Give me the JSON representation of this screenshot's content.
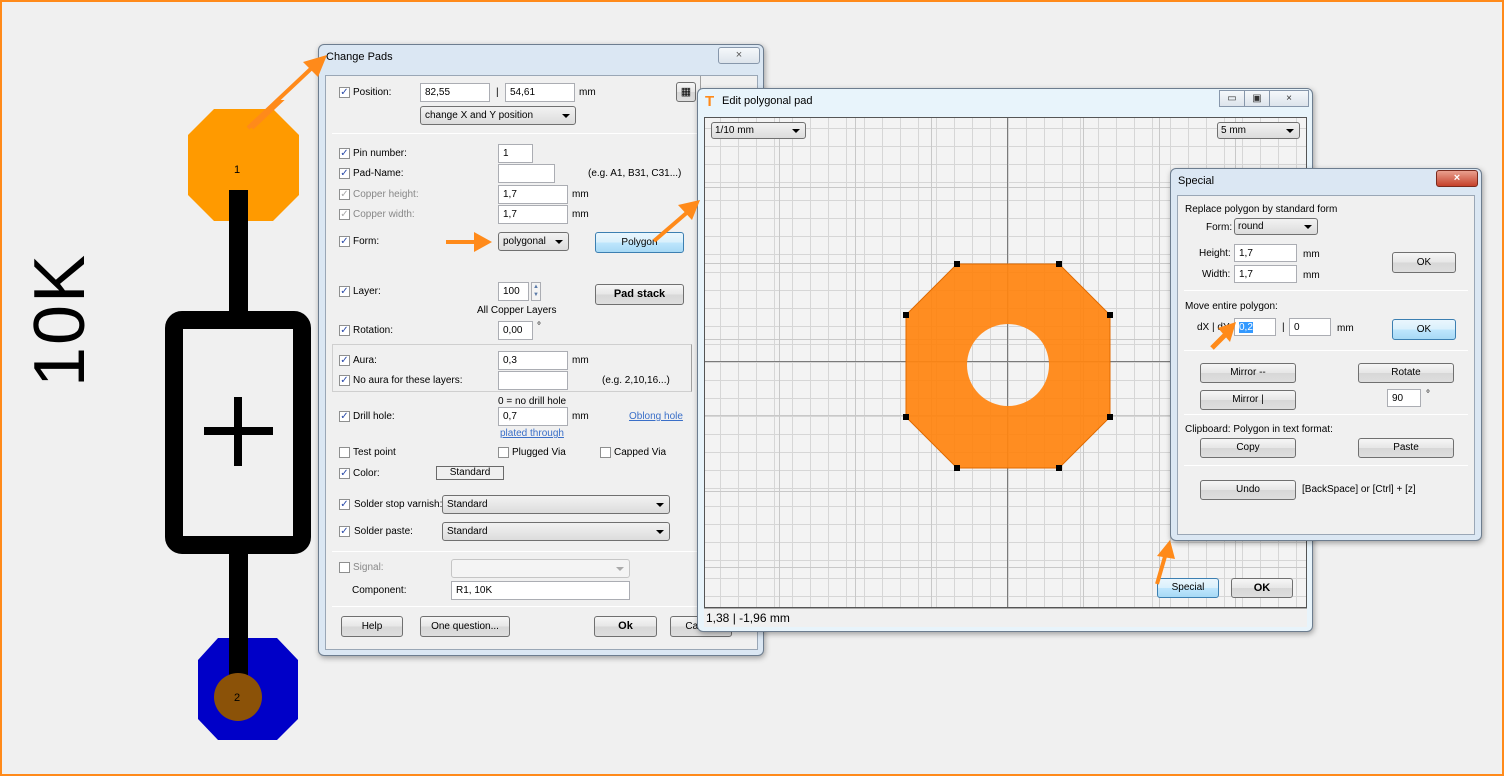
{
  "schematic": {
    "component_value_label": "10K",
    "pad1_number": "1",
    "pad2_number": "2",
    "colors": {
      "pad1": "#ff9a00",
      "pad2": "#0000c8",
      "pad2_drill": "#8b5208",
      "trace": "#000000",
      "annotation_arrow": "#ff8a1a"
    }
  },
  "change_pads": {
    "title": "Change Pads",
    "close_icon": "×",
    "position": {
      "label": "Position:",
      "checked": true,
      "x": "82,55",
      "separator": "|",
      "y": "54,61",
      "unit": "mm",
      "mode": "change X and Y position",
      "grid_icon": "grid-icon"
    },
    "pin_number": {
      "label": "Pin number:",
      "checked": true,
      "value": "1"
    },
    "pad_name": {
      "label": "Pad-Name:",
      "checked": true,
      "value": "",
      "hint": "(e.g. A1, B31, C31...)"
    },
    "copper_height": {
      "label": "Copper height:",
      "value": "1,7",
      "unit": "mm"
    },
    "copper_width": {
      "label": "Copper width:",
      "value": "1,7",
      "unit": "mm"
    },
    "form": {
      "label": "Form:",
      "checked": true,
      "value": "polygonal",
      "button": "Polygon"
    },
    "layer": {
      "label": "Layer:",
      "checked": true,
      "value": "100",
      "caption": "All Copper Layers",
      "button": "Pad stack"
    },
    "rotation": {
      "label": "Rotation:",
      "checked": true,
      "value": "0,00",
      "unit": "°"
    },
    "aura": {
      "label": "Aura:",
      "checked": true,
      "value": "0,3",
      "unit": "mm"
    },
    "no_aura": {
      "label": "No aura for these layers:",
      "checked": true,
      "value": "",
      "hint": "(e.g. 2,10,16...)"
    },
    "drill": {
      "label": "Drill hole:",
      "checked": true,
      "caption": "0 = no drill hole",
      "value": "0,7",
      "unit": "mm",
      "plated_link": "plated through",
      "oblong_link": "Oblong hole"
    },
    "test_point": {
      "label": "Test point",
      "checked": false
    },
    "plugged_via": {
      "label": "Plugged Via",
      "checked": false
    },
    "capped_via": {
      "label": "Capped Via",
      "checked": false
    },
    "color": {
      "label": "Color:",
      "checked": true,
      "value": "Standard"
    },
    "solder_stop": {
      "label": "Solder stop varnish:",
      "checked": true,
      "value": "Standard"
    },
    "solder_paste": {
      "label": "Solder paste:",
      "checked": true,
      "value": "Standard"
    },
    "signal": {
      "label": "Signal:",
      "checked": false,
      "value": ""
    },
    "component": {
      "label": "Component:",
      "value": "R1, 10K"
    },
    "buttons": {
      "help": "Help",
      "question": "One question...",
      "ok": "Ok",
      "cancel": "Cancel"
    }
  },
  "edit_polygon": {
    "title": "Edit polygonal pad",
    "grid_step": "1/10 mm",
    "grid_major": "5 mm",
    "status": "1,38 | -1,96 mm",
    "buttons": {
      "special": "Special",
      "ok": "OK"
    },
    "window_controls": {
      "minimize": "▭",
      "maximize": "▣",
      "close": "×"
    },
    "pad_color": "#ff8410"
  },
  "special": {
    "title": "Special",
    "close_icon": "×",
    "replace_heading": "Replace polygon by standard form",
    "form_label": "Form:",
    "form_value": "round",
    "height_label": "Height:",
    "height_value": "1,7",
    "width_label": "Width:",
    "width_value": "1,7",
    "unit": "mm",
    "ok1": "OK",
    "move_heading": "Move entire polygon:",
    "dxdy_label": "dX | dY:",
    "dx_value": "0,2",
    "separator": "|",
    "dy_value": "0",
    "ok2": "OK",
    "mirror_h": "Mirror  --",
    "mirror_v": "Mirror  |",
    "rotate": "Rotate",
    "rotate_value": "90",
    "degree": "°",
    "clipboard_heading": "Clipboard: Polygon in text format:",
    "copy": "Copy",
    "paste": "Paste",
    "undo": "Undo",
    "undo_hint": "[BackSpace] or [Ctrl] + [z]"
  }
}
